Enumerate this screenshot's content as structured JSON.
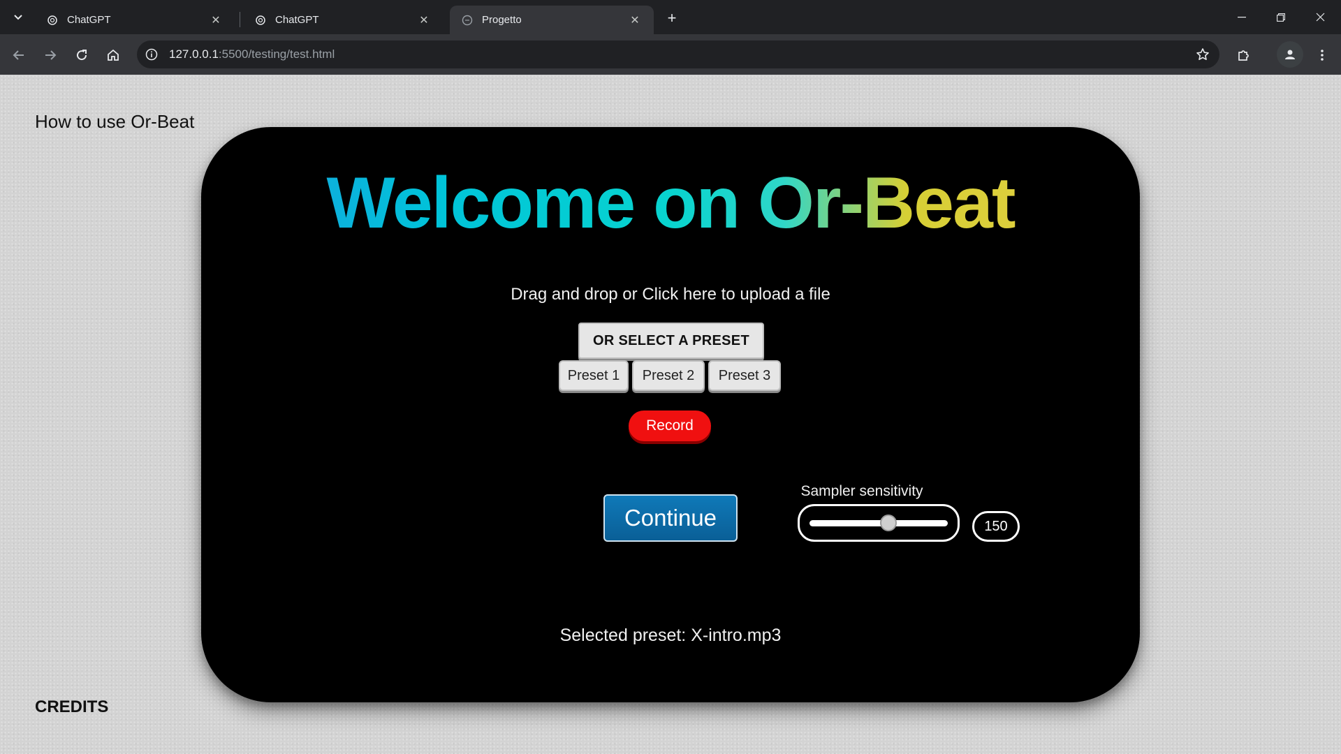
{
  "browser": {
    "tabs": [
      {
        "title": "ChatGPT",
        "icon": "openai-icon",
        "active": false
      },
      {
        "title": "ChatGPT",
        "icon": "openai-icon",
        "active": false
      },
      {
        "title": "Progetto",
        "icon": "globe-icon",
        "active": true
      }
    ],
    "url_host": "127.0.0.1",
    "url_path": ":5500/testing/test.html"
  },
  "page": {
    "help_link": "How to use Or-Beat",
    "credits": "CREDITS",
    "headline": "Welcome on Or-Beat",
    "upload_text": "Drag and drop or Click here to upload a file",
    "select_preset_label": "OR SELECT A PRESET",
    "presets": [
      "Preset 1",
      "Preset 2",
      "Preset 3"
    ],
    "record_label": "Record",
    "continue_label": "Continue",
    "sensitivity_label": "Sampler sensitivity",
    "sensitivity_value": "150",
    "sensitivity_fraction": 0.57,
    "selected_preset_text": "Selected preset: X-intro.mp3"
  },
  "colors": {
    "record": "#f01010",
    "continue": "#0a6ba8",
    "card": "#000000",
    "headline_gradient": [
      "#1a9ce0",
      "#00c3d9",
      "#d6cf35"
    ]
  }
}
